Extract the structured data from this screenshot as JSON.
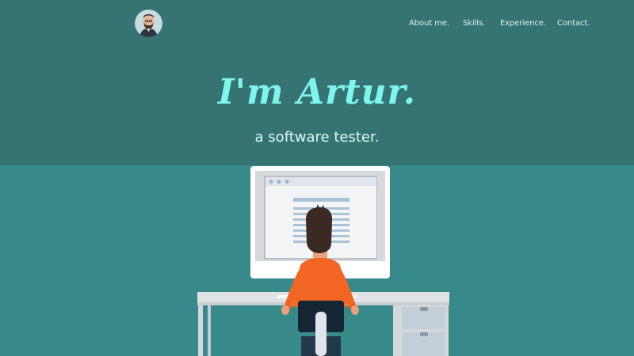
{
  "nav": {
    "items": [
      {
        "label": "About me."
      },
      {
        "label": "Skills."
      },
      {
        "label": "Experience."
      },
      {
        "label": "Contact."
      }
    ]
  },
  "hero": {
    "headline": "I'm Artur.",
    "subline": "a software tester."
  },
  "icons": {
    "avatar": "avatar-photo"
  },
  "colors": {
    "header_bg": "#367473",
    "body_bg": "#378a89",
    "headline": "#7ff6ec",
    "accent_shirt": "#f26522"
  }
}
